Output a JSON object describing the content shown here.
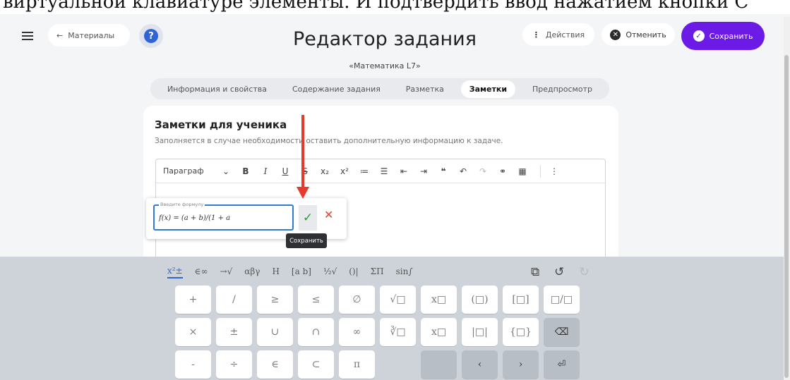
{
  "banner": {
    "text": "виртуальной клавиатуре элементы. И подтвердить ввод нажатием кнопки С"
  },
  "header": {
    "back_label": "Материалы",
    "title": "Редактор задания",
    "subtitle": "«Математика L7»",
    "actions_label": "Действия",
    "cancel_label": "Отменить",
    "save_label": "Сохранить"
  },
  "tabs": [
    {
      "label": "Информация и свойства"
    },
    {
      "label": "Содержание задания"
    },
    {
      "label": "Разметка"
    },
    {
      "label": "Заметки",
      "active": true
    },
    {
      "label": "Предпросмотр"
    }
  ],
  "notes": {
    "title": "Заметки для ученика",
    "description": "Заполняется в случае необходимости оставить дополнительную информацию к задаче."
  },
  "editor": {
    "paragraph_select": "Параграф"
  },
  "formula": {
    "label": "Введите формулу",
    "value": "f(x) = (a + b)/(1 + a",
    "tooltip": "Сохранить"
  },
  "keyboard": {
    "tabs": [
      "x²±",
      "∈∞",
      "→√",
      "αβγ",
      "H",
      "[a b]",
      "½√",
      "()|",
      "ΣΠ",
      "sin∫"
    ],
    "active_tab": 0,
    "keys": [
      [
        "+",
        "/",
        "≥",
        "≤",
        "∅",
        "√□",
        "x□",
        "(□)",
        "[□]",
        "□/□"
      ],
      [
        "×",
        "±",
        "∪",
        "∩",
        "∞",
        "∛□",
        "x□",
        "|□|",
        "{□}",
        "⌫"
      ],
      [
        "-",
        "÷",
        "∈",
        "⊂",
        "π",
        "",
        "",
        "‹",
        "›",
        "⏎"
      ]
    ]
  },
  "colors": {
    "accent": "#6c1ae6",
    "arrow": "#e53b2c",
    "confirm": "#2f9a3a",
    "cancel": "#d84a2e"
  }
}
